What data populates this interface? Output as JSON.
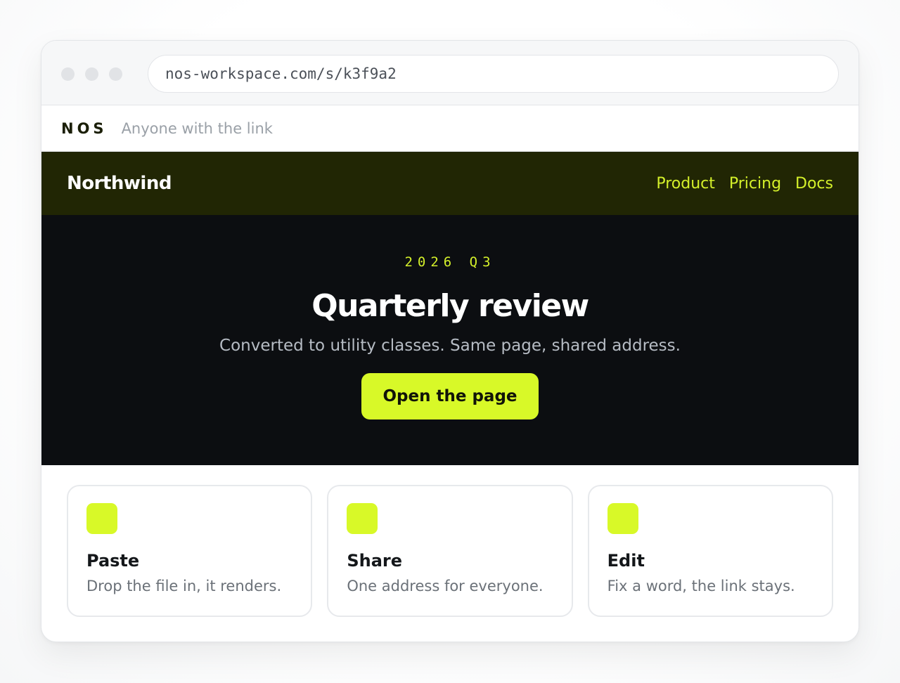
{
  "browser": {
    "url": "nos-workspace.com/s/k3f9a2"
  },
  "share_bar": {
    "logo": "NOS",
    "visibility": "Anyone with the link"
  },
  "site": {
    "brand": "Northwind",
    "nav": [
      {
        "label": "Product"
      },
      {
        "label": "Pricing"
      },
      {
        "label": "Docs"
      }
    ]
  },
  "hero": {
    "eyebrow": "2026 Q3",
    "title": "Quarterly review",
    "subtitle": "Converted to utility classes. Same page, shared address.",
    "cta_label": "Open the page"
  },
  "features": [
    {
      "title": "Paste",
      "description": "Drop the file in, it renders."
    },
    {
      "title": "Share",
      "description": "One address for everyone."
    },
    {
      "title": "Edit",
      "description": "Fix a word, the link stays."
    }
  ],
  "colors": {
    "accent": "#d8f928",
    "nav_background": "#212604",
    "hero_background": "#0c0e11"
  }
}
